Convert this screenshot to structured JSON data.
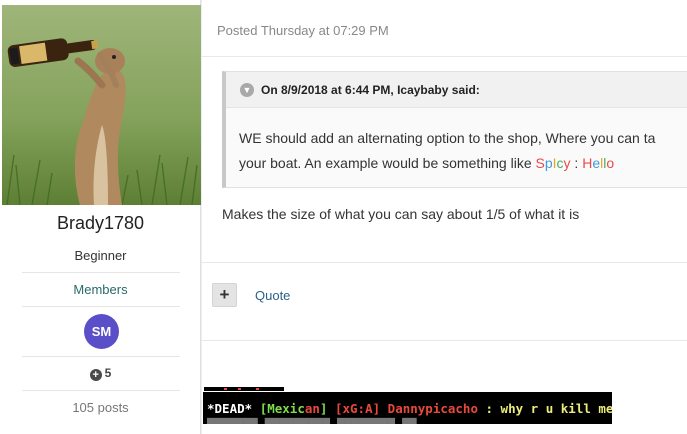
{
  "author": {
    "username": "Brady1780",
    "rank": "Beginner",
    "group": "Members",
    "badge_initials": "SM",
    "badge_color": "#5b4fc9",
    "reputation": "5",
    "post_count": "105 posts"
  },
  "post": {
    "posted": "Posted Thursday at 07:29 PM",
    "quote": {
      "header": "On 8/9/2018 at 6:44 PM, Icaybaby said:",
      "line1": "WE should add an alternating option to the shop, Where you can ta",
      "line2_prefix": "your boat. An example would be something like ",
      "spicy": [
        "S",
        "p",
        "I",
        "c",
        "y"
      ],
      "separator": " : ",
      "hello": [
        "H",
        "e",
        "l",
        "l",
        "o"
      ]
    },
    "text": "Makes the size of what you can say about 1/5 of what it is",
    "actions": {
      "add_label": "+",
      "quote_label": "Quote"
    }
  },
  "game_chat": {
    "dead_tag": "*DEAD*",
    "open_bracket": "[",
    "team_part1": "Mexic",
    "team_part2": "an",
    "close_bracket": "]",
    "clan_tag": "[xG:A]",
    "player": "Dannypicacho",
    "message": " : why r u kill me",
    "colors": {
      "white": "#ffffff",
      "green": "#7bdc4e",
      "red": "#e74a3c",
      "yellow": "#ecec7c"
    }
  }
}
